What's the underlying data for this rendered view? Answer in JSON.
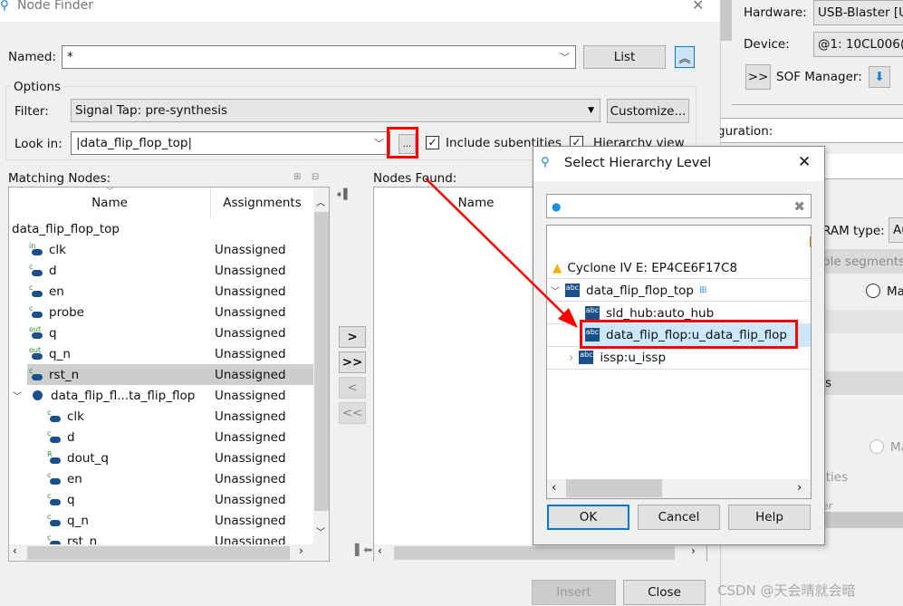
{
  "node_finder": {
    "title": "Node Finder",
    "named_label": "Named:",
    "named_value": "*",
    "list_button": "List",
    "options_label": "Options",
    "filter_label": "Filter:",
    "filter_value": "Signal Tap: pre-synthesis",
    "customize_button": "Customize...",
    "look_in_label": "Look in:",
    "look_in_value": "|data_flip_flop_top|",
    "browse_button": "...",
    "include_subentities": {
      "label": "Include subentities",
      "checked": true
    },
    "hierarchy_view": {
      "label": "Hierarchy view",
      "checked": true
    },
    "matching_nodes_label": "Matching Nodes:",
    "columns": [
      "Name",
      "Assignments"
    ],
    "rows": [
      {
        "name": "data_flip_flop_top",
        "assign": "",
        "icon": "none",
        "indent": 0
      },
      {
        "name": "clk",
        "assign": "Unassigned",
        "icon": "in",
        "indent": 1
      },
      {
        "name": "d",
        "assign": "Unassigned",
        "icon": "C",
        "indent": 1
      },
      {
        "name": "en",
        "assign": "Unassigned",
        "icon": "C",
        "indent": 1
      },
      {
        "name": "probe",
        "assign": "Unassigned",
        "icon": "C",
        "indent": 1
      },
      {
        "name": "q",
        "assign": "Unassigned",
        "icon": "out",
        "indent": 1
      },
      {
        "name": "q_n",
        "assign": "Unassigned",
        "icon": "out",
        "indent": 1
      },
      {
        "name": "rst_n",
        "assign": "Unassigned",
        "icon": "C",
        "indent": 1,
        "selected": true
      },
      {
        "name": "data_flip_fl...ta_flip_flop",
        "assign": "Unassigned",
        "icon": "instance",
        "indent": 1,
        "expanded": true
      },
      {
        "name": "clk",
        "assign": "Unassigned",
        "icon": "C",
        "indent": 2
      },
      {
        "name": "d",
        "assign": "Unassigned",
        "icon": "C",
        "indent": 2
      },
      {
        "name": "dout_q",
        "assign": "Unassigned",
        "icon": "R",
        "indent": 2
      },
      {
        "name": "en",
        "assign": "Unassigned",
        "icon": "C",
        "indent": 2
      },
      {
        "name": "q",
        "assign": "Unassigned",
        "icon": "C",
        "indent": 2
      },
      {
        "name": "q_n",
        "assign": "Unassigned",
        "icon": "C",
        "indent": 2
      },
      {
        "name": "rst_n",
        "assign": "Unassigned",
        "icon": "C",
        "indent": 2
      }
    ],
    "nodes_found_label": "Nodes Found:",
    "nodes_found_column": "Name",
    "move_buttons": [
      ">",
      ">>",
      "<",
      "<<"
    ],
    "insert_button": "Insert",
    "close_button": "Close"
  },
  "dialog": {
    "title": "Select Hierarchy Level",
    "search_value": "",
    "tree": [
      {
        "label": "Cyclone IV E: EP4CE6F17C8",
        "icon": "warning-device"
      },
      {
        "label": "data_flip_flop_top",
        "icon": "abc-v",
        "expanded": true
      },
      {
        "label": "sld_hub:auto_hub",
        "icon": "abc-vhd"
      },
      {
        "label": "data_flip_flop:u_data_flip_flop",
        "icon": "abc-v",
        "selected": true
      },
      {
        "label": "issp:u_issp",
        "icon": "abc-v",
        "collapsed": true
      }
    ],
    "ok_button": "OK",
    "cancel_button": "Cancel",
    "help_button": "Help"
  },
  "background_app": {
    "hardware_label": "Hardware:",
    "hardware_value": "USB-Blaster [U",
    "device_label": "Device:",
    "device_value": "@1: 10CL006(",
    "expand_button": ">>",
    "sof_label": "SOF Manager:",
    "configuration_label": "guration:",
    "ram_type_label": "RAM type:",
    "ram_type_value": "Au",
    "segments_label": "ple segments",
    "radio1_label": "Ma",
    "s_label": "s",
    "radio2_label": "Ma",
    "ities_label": "ities",
    "er_label": "er"
  },
  "watermark": "CSDN @天会晴就会暗",
  "colors": {
    "annotation_red": "#ff0000",
    "selection": "#cce8ff",
    "icon_blue": "#1b4f8a"
  }
}
